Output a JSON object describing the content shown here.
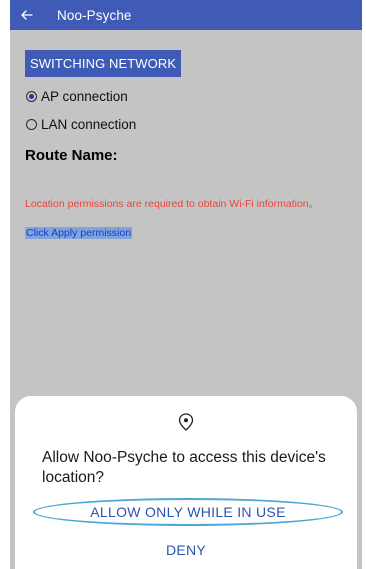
{
  "app_bar": {
    "back_icon": "arrow-left-icon",
    "title": "Noo-Psyche"
  },
  "main": {
    "switch_button_label": "SWITCHING NETWORK",
    "connection_options": [
      {
        "label": "AP connection",
        "selected": true
      },
      {
        "label": "LAN connection",
        "selected": false
      }
    ],
    "route_name_label": "Route Name:",
    "permission_message": "Location permissions are required to obtain Wi-Fi information。",
    "apply_link": "Click Apply permission"
  },
  "dialog": {
    "icon": "location-target-icon",
    "title": "Allow Noo-Psyche to access this device's location?",
    "allow_label": "ALLOW ONLY WHILE IN USE",
    "deny_label": "DENY"
  },
  "colors": {
    "accent": "#3f5bb5",
    "error_text": "#e8463a",
    "link_text": "#1f33c8",
    "dialog_button_text": "#2b54b0",
    "highlight_ring": "#4ea7d6",
    "dim_background": "#c4c4c4"
  }
}
